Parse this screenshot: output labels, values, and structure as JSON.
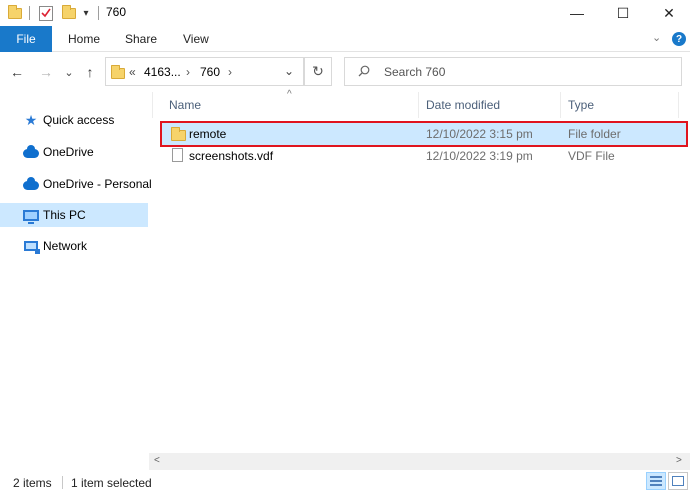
{
  "window": {
    "title": "760",
    "qat_dropdown": "▾",
    "controls": {
      "minimize": "—",
      "maximize": "☐",
      "close": "✕"
    }
  },
  "ribbon": {
    "tabs": [
      "File",
      "Home",
      "Share",
      "View"
    ],
    "expand": "⌄",
    "help": "?"
  },
  "address": {
    "back": "←",
    "forward": "→",
    "recent": "⌄",
    "up": "↑",
    "overflow": "«",
    "crumbs": [
      "4163...",
      "760"
    ],
    "separator": "›",
    "dropdown": "⌄",
    "refresh": "↻"
  },
  "search": {
    "placeholder": "Search 760",
    "icon": "search-icon"
  },
  "sidebar": {
    "items": [
      {
        "label": "Quick access",
        "icon": "star-icon"
      },
      {
        "label": "OneDrive",
        "icon": "cloud-icon"
      },
      {
        "label": "OneDrive - Personal",
        "icon": "cloud-icon"
      },
      {
        "label": "This PC",
        "icon": "computer-icon",
        "selected": true
      },
      {
        "label": "Network",
        "icon": "network-icon"
      }
    ]
  },
  "columns": {
    "name": "Name",
    "date": "Date modified",
    "type": "Type",
    "sort_indicator": "^"
  },
  "files": [
    {
      "name": "remote",
      "date": "12/10/2022 3:15 pm",
      "type": "File folder",
      "icon": "folder-icon",
      "selected": true
    },
    {
      "name": "screenshots.vdf",
      "date": "12/10/2022 3:19 pm",
      "type": "VDF File",
      "icon": "document-icon",
      "selected": false
    }
  ],
  "scrollbar": {
    "left": "<",
    "right": ">"
  },
  "status": {
    "item_count": "2 items",
    "selection": "1 item selected"
  },
  "colors": {
    "accent": "#1979ca",
    "selection": "#cce8ff",
    "highlight_outline": "#e0141e"
  }
}
